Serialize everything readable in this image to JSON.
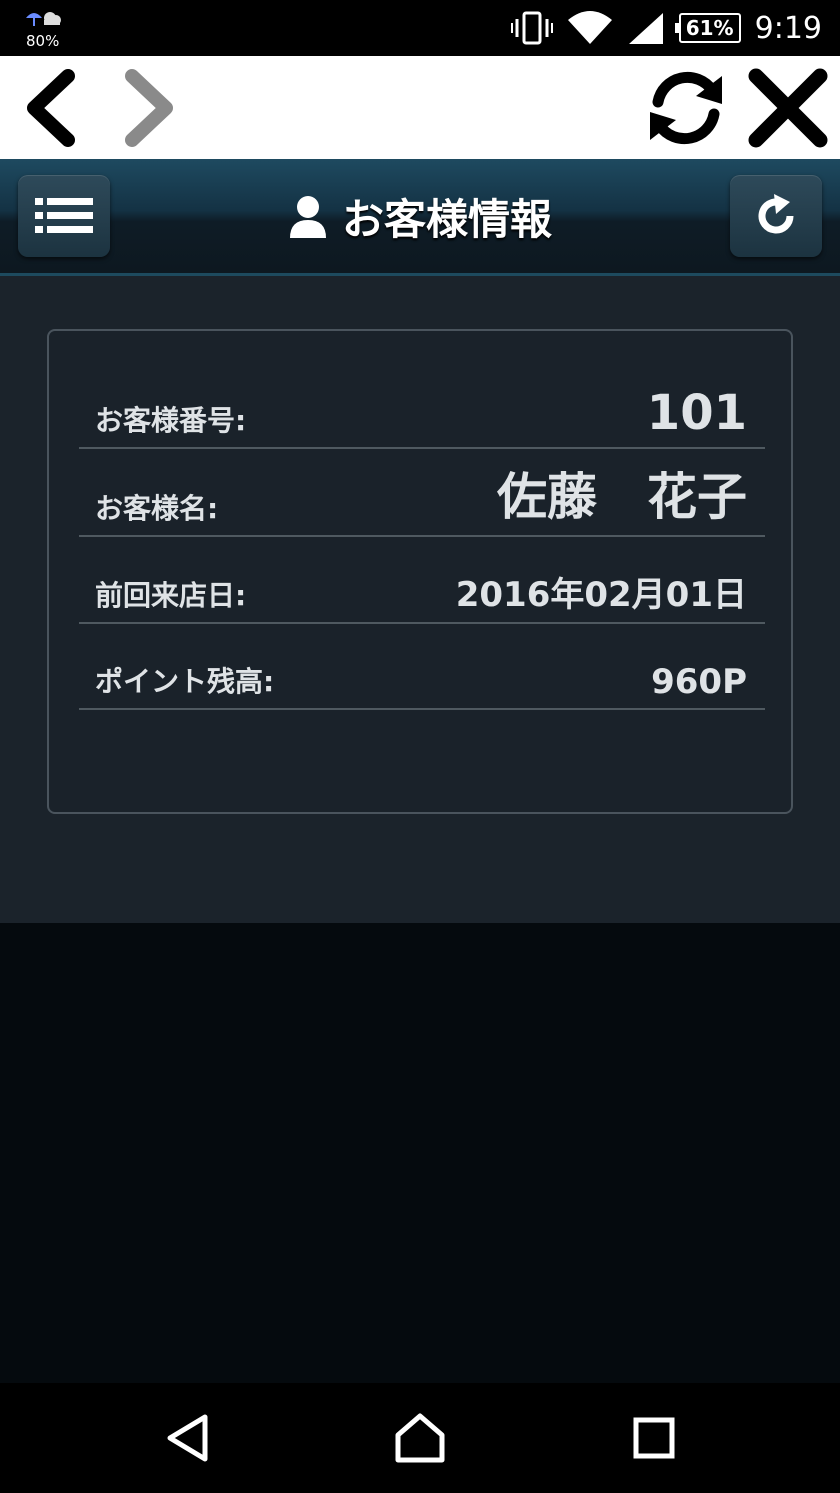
{
  "status_bar": {
    "weather_percent": "80%",
    "battery": "61%",
    "time": "9:19"
  },
  "header": {
    "title": "お客様情報"
  },
  "customer": {
    "rows": [
      {
        "label": "お客様番号:",
        "value": "101"
      },
      {
        "label": "お客様名:",
        "value": "佐藤　花子"
      },
      {
        "label": "前回来店日:",
        "value": "2016年02月01日"
      },
      {
        "label": "ポイント残高:",
        "value": "960P"
      }
    ]
  },
  "icons": {
    "browser_back": "chevron-left-icon",
    "browser_forward": "chevron-right-icon",
    "browser_reload": "sync-icon",
    "browser_close": "close-icon",
    "menu": "list-icon",
    "refresh": "refresh-icon",
    "user": "user-icon"
  },
  "colors": {
    "header_top": "#1e4a60",
    "content_bg": "#1b232b",
    "text": "#dfe3e6"
  }
}
